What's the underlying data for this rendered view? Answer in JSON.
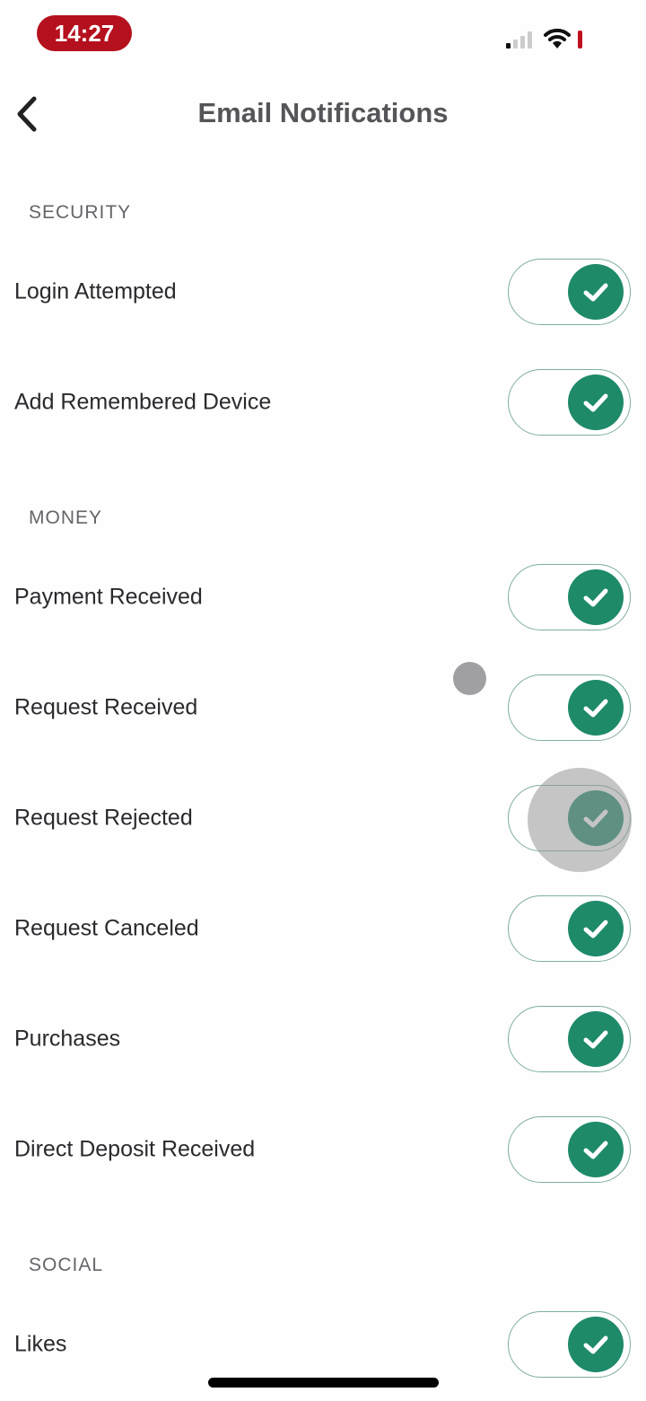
{
  "status_bar": {
    "time": "14:27"
  },
  "header": {
    "title": "Email Notifications",
    "back_icon": "chevron-left-icon"
  },
  "colors": {
    "accent": "#1e8a6a",
    "time_pill": "#b5101d"
  },
  "sections": [
    {
      "title": "SECURITY",
      "items": [
        {
          "label": "Login Attempted",
          "enabled": true
        },
        {
          "label": "Add Remembered Device",
          "enabled": true
        }
      ]
    },
    {
      "title": "MONEY",
      "items": [
        {
          "label": "Payment Received",
          "enabled": true
        },
        {
          "label": "Request Received",
          "enabled": true
        },
        {
          "label": "Request Rejected",
          "enabled": true
        },
        {
          "label": "Request Canceled",
          "enabled": true
        },
        {
          "label": "Purchases",
          "enabled": true
        },
        {
          "label": "Direct Deposit Received",
          "enabled": true
        }
      ]
    },
    {
      "title": "SOCIAL",
      "items": [
        {
          "label": "Likes",
          "enabled": true
        }
      ]
    }
  ]
}
